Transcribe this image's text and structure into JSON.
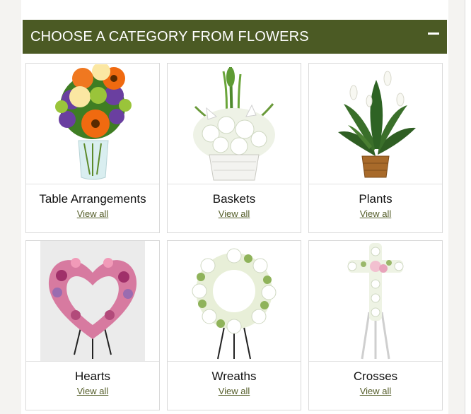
{
  "header": {
    "title": "CHOOSE A CATEGORY FROM FLOWERS"
  },
  "categories": [
    {
      "name": "Table Arrangements",
      "link": "View all",
      "icon": "vase-bouquet-icon"
    },
    {
      "name": "Baskets",
      "link": "View all",
      "icon": "white-basket-icon"
    },
    {
      "name": "Plants",
      "link": "View all",
      "icon": "peace-lily-plant-icon"
    },
    {
      "name": "Hearts",
      "link": "View all",
      "icon": "floral-heart-icon"
    },
    {
      "name": "Wreaths",
      "link": "View all",
      "icon": "floral-wreath-icon"
    },
    {
      "name": "Crosses",
      "link": "View all",
      "icon": "floral-cross-icon"
    }
  ],
  "colors": {
    "header_bg": "#4b5a24",
    "link": "#555e2a",
    "accent_orange": "#f06a10",
    "purple": "#6a3fa0"
  }
}
